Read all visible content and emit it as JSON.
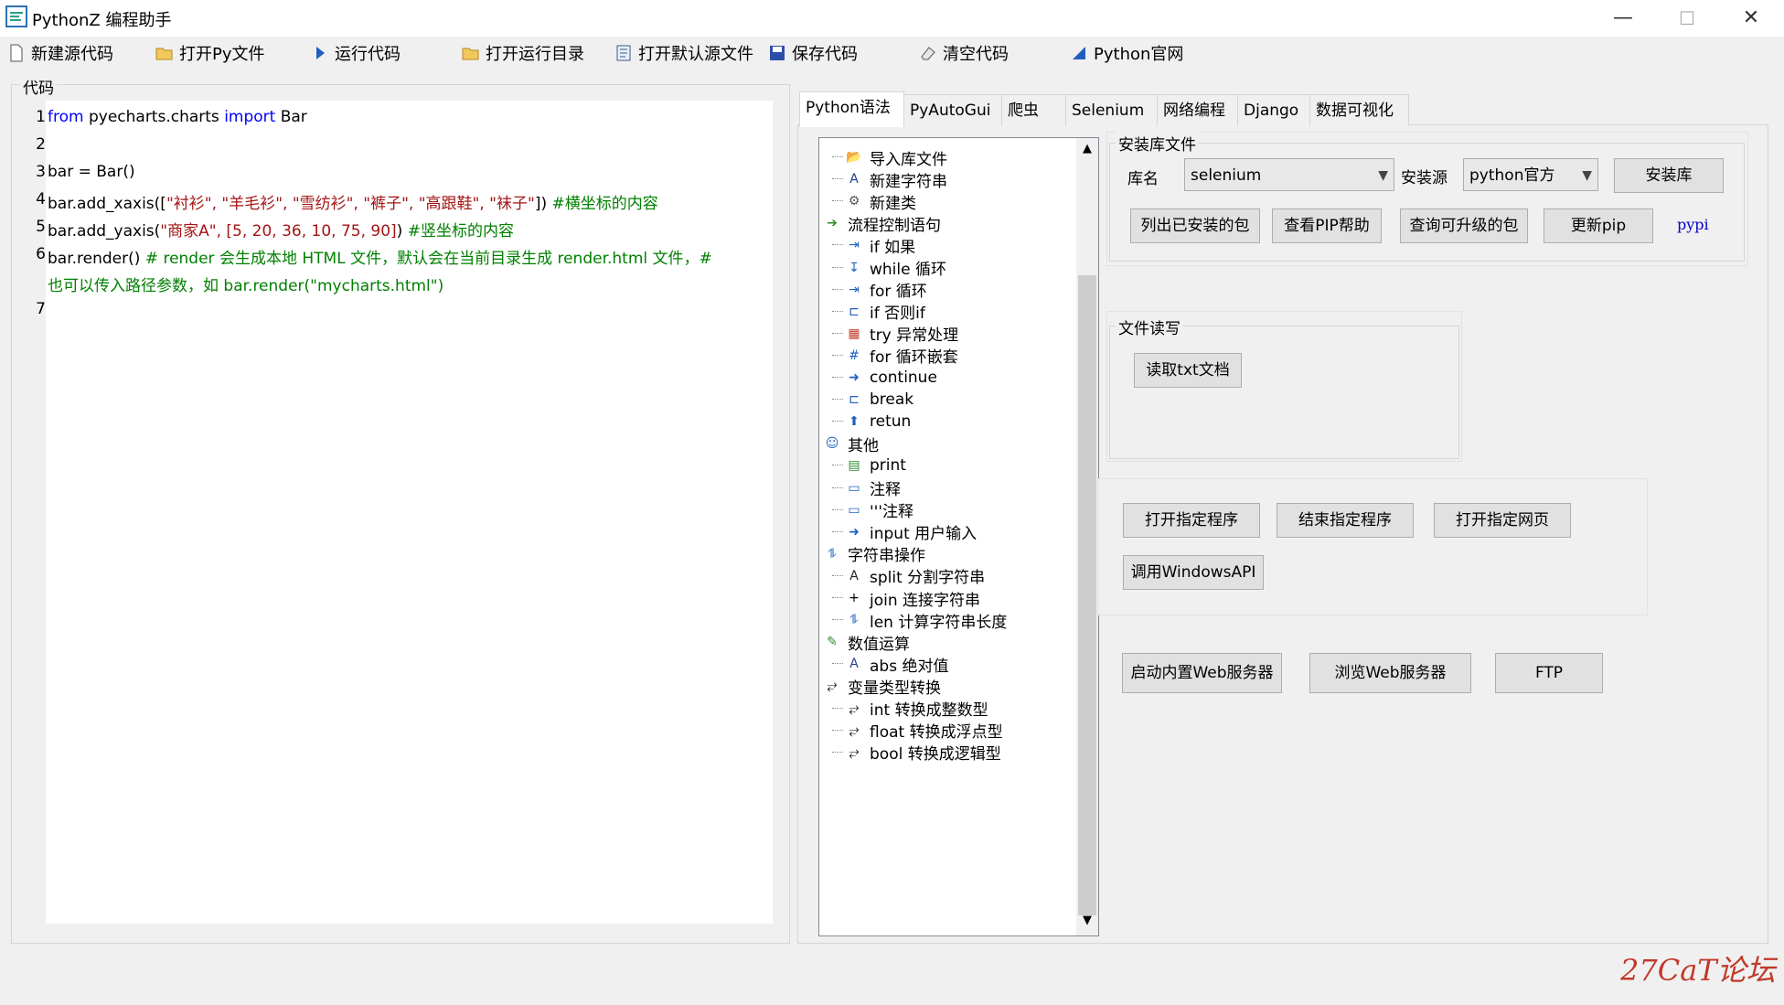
{
  "window": {
    "title": "PythonZ 编程助手",
    "minimize": "—",
    "maximize": "☐",
    "close": "✕"
  },
  "toolbar": {
    "new_code": "新建源代码",
    "open_py": "打开Py文件",
    "run_code": "运行代码",
    "open_run_dir": "打开运行目录",
    "open_default_src": "打开默认源文件",
    "save_code": "保存代码",
    "clear_code": "清空代码",
    "python_site": "Python官网"
  },
  "code_panel": {
    "label": "代码",
    "lines": [
      {
        "n": "1",
        "segments": [
          {
            "t": "from",
            "c": "kw"
          },
          {
            "t": " pyecharts.charts ",
            "c": ""
          },
          {
            "t": "import",
            "c": "kw"
          },
          {
            "t": " Bar",
            "c": ""
          }
        ]
      },
      {
        "n": "2",
        "segments": []
      },
      {
        "n": "3",
        "segments": [
          {
            "t": "bar = Bar()",
            "c": ""
          }
        ]
      },
      {
        "n": "4",
        "segments": [
          {
            "t": "bar.add_xaxis([",
            "c": ""
          },
          {
            "t": "\"衬衫\", \"羊毛衫\", \"雪纺衫\", \"裤子\", \"高跟鞋\", \"袜子\"",
            "c": "str"
          },
          {
            "t": "])  ",
            "c": ""
          },
          {
            "t": "#横坐标的内容",
            "c": "cmt"
          }
        ]
      },
      {
        "n": "5",
        "segments": [
          {
            "t": "bar.add_yaxis(",
            "c": ""
          },
          {
            "t": "\"商家A\", [5, 20, 36, 10, 75, 90]",
            "c": "str"
          },
          {
            "t": ")  ",
            "c": ""
          },
          {
            "t": "#竖坐标的内容",
            "c": "cmt"
          }
        ]
      },
      {
        "n": "6",
        "segments": [
          {
            "t": "bar.render() ",
            "c": ""
          },
          {
            "t": "# render 会生成本地 HTML 文件，默认会在当前目录生成 render.html 文件，#",
            "c": "cmt"
          }
        ]
      },
      {
        "n": "",
        "segments": [
          {
            "t": "也可以传入路径参数，如 bar.render(\"mycharts.html\")",
            "c": "cmt"
          }
        ]
      },
      {
        "n": "7",
        "segments": []
      }
    ]
  },
  "tabs": [
    "Python语法",
    "PyAutoGui",
    "爬虫",
    "Selenium",
    "网络编程",
    "Django",
    "数据可视化"
  ],
  "tree": [
    {
      "label": "导入库文件",
      "level": 1,
      "icon": "folder-icon"
    },
    {
      "label": "新建字符串",
      "level": 1,
      "icon": "letter-a-icon"
    },
    {
      "label": "新建类",
      "level": 1,
      "icon": "class-icon"
    },
    {
      "label": "流程控制语句",
      "level": 0,
      "icon": "arrows-icon"
    },
    {
      "label": "if 如果",
      "level": 1,
      "icon": "if-icon"
    },
    {
      "label": "while 循环",
      "level": 1,
      "icon": "while-icon"
    },
    {
      "label": "for 循环",
      "level": 1,
      "icon": "for-icon"
    },
    {
      "label": "if 否则if",
      "level": 1,
      "icon": "elif-icon"
    },
    {
      "label": "try 异常处理",
      "level": 1,
      "icon": "try-icon"
    },
    {
      "label": "for 循环嵌套",
      "level": 1,
      "icon": "grid-icon"
    },
    {
      "label": "continue",
      "level": 1,
      "icon": "arrow-right-icon"
    },
    {
      "label": "break",
      "level": 1,
      "icon": "break-icon"
    },
    {
      "label": "retun",
      "level": 1,
      "icon": "arrow-up-icon"
    },
    {
      "label": "其他",
      "level": 0,
      "icon": "smiley-icon"
    },
    {
      "label": "print",
      "level": 1,
      "icon": "print-icon"
    },
    {
      "label": "注释",
      "level": 1,
      "icon": "comment-icon"
    },
    {
      "label": "'''注释",
      "level": 1,
      "icon": "comment-icon"
    },
    {
      "label": "input 用户输入",
      "level": 1,
      "icon": "arrow-right-icon"
    },
    {
      "label": "字符串操作",
      "level": 0,
      "icon": "string-ops-icon"
    },
    {
      "label": "split 分割字符串",
      "level": 1,
      "icon": "split-icon"
    },
    {
      "label": "join 连接字符串",
      "level": 1,
      "icon": "plus-icon"
    },
    {
      "label": "len 计算字符串长度",
      "level": 1,
      "icon": "string-ops-icon"
    },
    {
      "label": "数值运算",
      "level": 0,
      "icon": "math-icon"
    },
    {
      "label": "abs 绝对值",
      "level": 1,
      "icon": "letter-a-icon"
    },
    {
      "label": "变量类型转换",
      "level": 0,
      "icon": "convert-icon"
    },
    {
      "label": "int 转换成整数型",
      "level": 1,
      "icon": "convert-icon"
    },
    {
      "label": "float 转换成浮点型",
      "level": 1,
      "icon": "convert-icon"
    },
    {
      "label": "bool 转换成逻辑型",
      "level": 1,
      "icon": "convert-icon"
    }
  ],
  "install": {
    "group_label": "安装库文件",
    "lib_label": "库名",
    "lib_value": "selenium",
    "source_label": "安装源",
    "source_value": "python官方",
    "install_btn": "安装库",
    "list_installed": "列出已安装的包",
    "pip_help": "查看PIP帮助",
    "upgradable": "查询可升级的包",
    "update_pip": "更新pip",
    "pypi": "pypi"
  },
  "file_rw": {
    "group_label": "文件读写",
    "read_txt": "读取txt文档"
  },
  "programs": {
    "open_program": "打开指定程序",
    "end_program": "结束指定程序",
    "open_webpage": "打开指定网页",
    "windows_api": "调用WindowsAPI"
  },
  "web": {
    "start_server": "启动内置Web服务器",
    "browse_server": "浏览Web服务器",
    "ftp": "FTP"
  },
  "watermark": "27CaT论坛",
  "colors": {
    "keyword": "#0000ff",
    "string": "#a31515",
    "comment": "#008000",
    "pypi_link": "#0000cc",
    "watermark": "#c0392b"
  }
}
